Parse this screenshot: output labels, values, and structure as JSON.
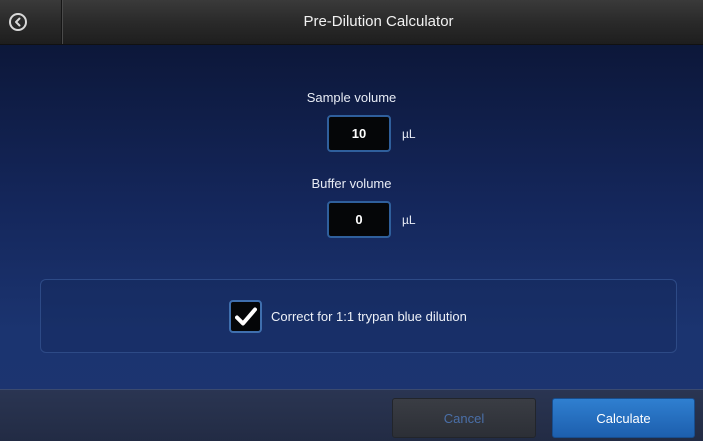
{
  "header": {
    "title": "Pre-Dilution Calculator",
    "back_icon": "back-arrow-icon"
  },
  "sample": {
    "label": "Sample volume",
    "value": "10",
    "unit": "µL"
  },
  "buffer": {
    "label": "Buffer volume",
    "value": "0",
    "unit": "µL"
  },
  "trypan": {
    "label": "Correct for 1:1 trypan blue dilution",
    "checked": true
  },
  "footer": {
    "cancel_label": "Cancel",
    "calculate_label": "Calculate"
  },
  "colors": {
    "accent": "#2f7fd0",
    "header_bg": "#2a2a2a",
    "body_bg": "#14265a"
  }
}
